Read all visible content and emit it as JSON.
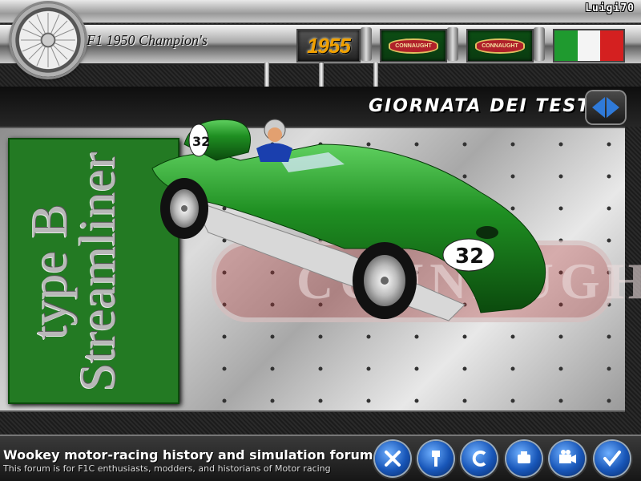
{
  "header": {
    "user": "Luigi70",
    "app_title": "F1 1950 Champion's",
    "year": "1955",
    "logo_left": "CONNAUGHT",
    "logo_right": "CONNAUGHT"
  },
  "flag_colors": [
    "#1f9a2f",
    "#f4f4f4",
    "#d42020"
  ],
  "section_title": "GIORNATA DEI TEST",
  "car": {
    "name_line1": "type B",
    "name_line2": "Streamliner",
    "number": "32",
    "watermark": "CONNAUGHT",
    "body_color": "#1f8f22"
  },
  "footer": {
    "title": "Wookey motor-racing history and simulation forum",
    "subtitle": "This forum is for F1C enthusiasts, modders, and historians of Motor racing"
  },
  "buttons": [
    {
      "icon": "close-x-icon"
    },
    {
      "icon": "piston-icon"
    },
    {
      "icon": "back-arrow-icon"
    },
    {
      "icon": "engine-icon"
    },
    {
      "icon": "camera-icon"
    },
    {
      "icon": "checkmark-icon"
    }
  ],
  "colors": {
    "accent": "#1856b8",
    "panel_green": "#237a23"
  }
}
